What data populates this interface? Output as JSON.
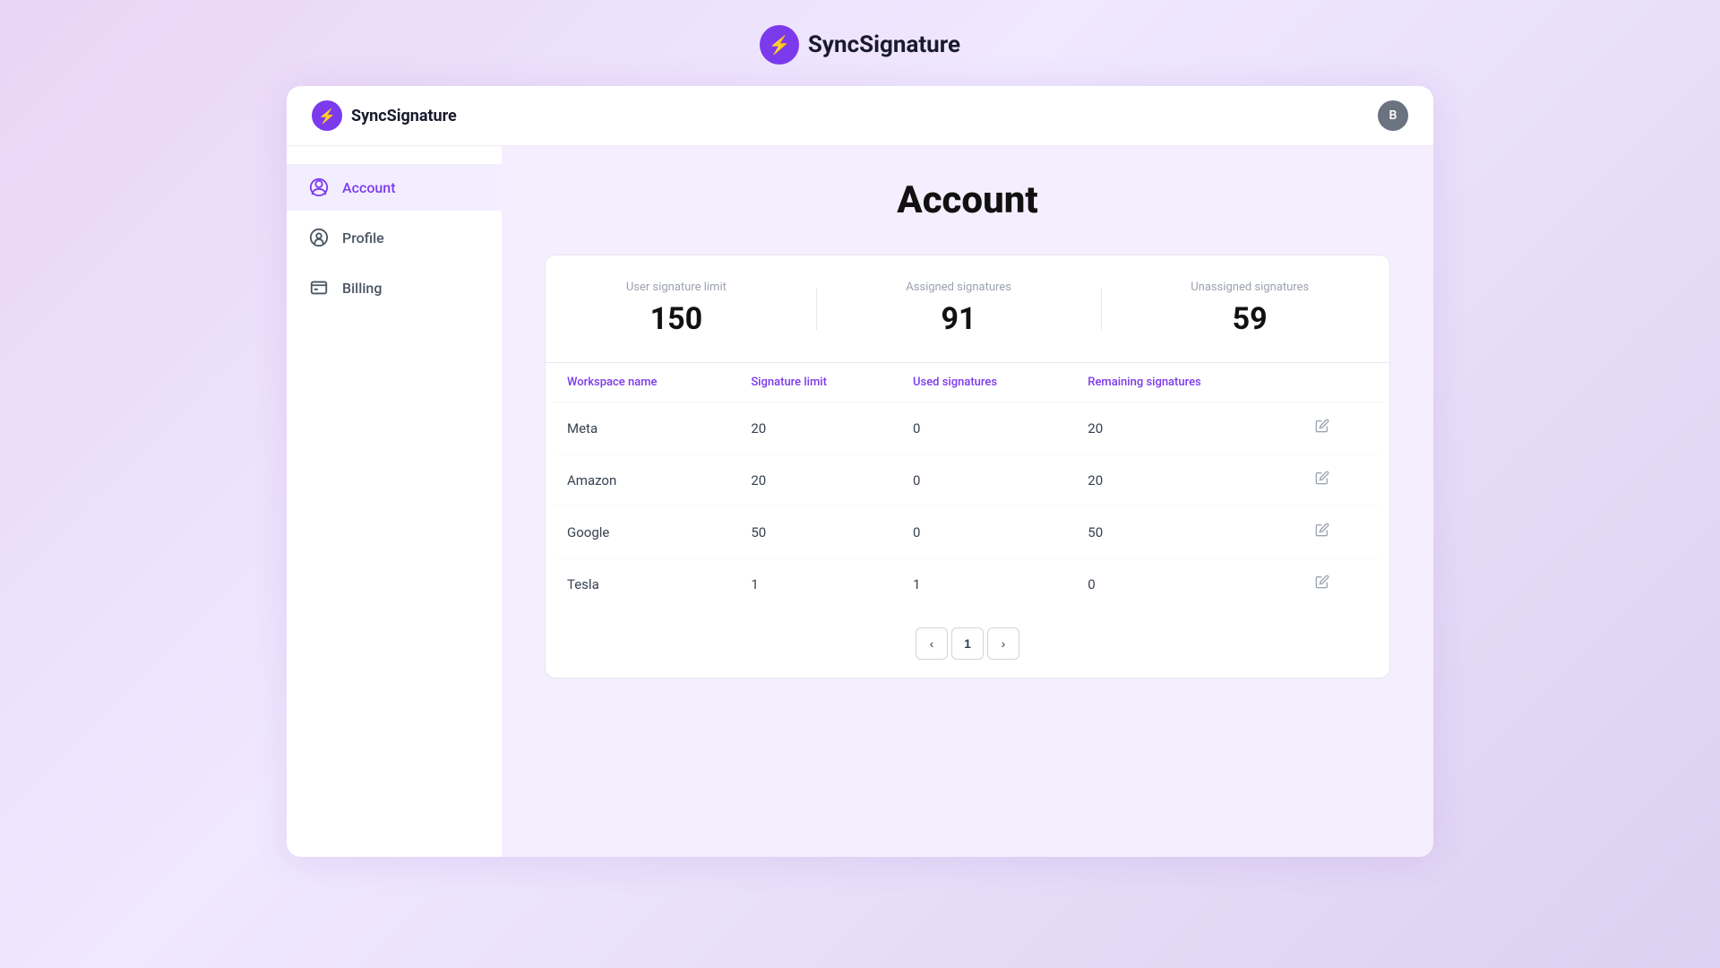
{
  "brand": {
    "name": "SyncSignature",
    "logo_icon": "⚡"
  },
  "header": {
    "avatar_letter": "B"
  },
  "sidebar": {
    "items": [
      {
        "id": "account",
        "label": "Account",
        "icon": "account",
        "active": true
      },
      {
        "id": "profile",
        "label": "Profile",
        "icon": "profile",
        "active": false
      },
      {
        "id": "billing",
        "label": "Billing",
        "icon": "billing",
        "active": false
      }
    ]
  },
  "main": {
    "page_title": "Account",
    "stats": {
      "user_signature_limit_label": "User signature limit",
      "user_signature_limit_value": "150",
      "assigned_signatures_label": "Assigned signatures",
      "assigned_signatures_value": "91",
      "unassigned_signatures_label": "Unassigned signatures",
      "unassigned_signatures_value": "59"
    },
    "table": {
      "columns": [
        {
          "id": "workspace_name",
          "label": "Workspace name"
        },
        {
          "id": "signature_limit",
          "label": "Signature limit"
        },
        {
          "id": "used_signatures",
          "label": "Used signatures"
        },
        {
          "id": "remaining_signatures",
          "label": "Remaining signatures"
        }
      ],
      "rows": [
        {
          "workspace_name": "Meta",
          "signature_limit": "20",
          "used_signatures": "0",
          "remaining_signatures": "20"
        },
        {
          "workspace_name": "Amazon",
          "signature_limit": "20",
          "used_signatures": "0",
          "remaining_signatures": "20"
        },
        {
          "workspace_name": "Google",
          "signature_limit": "50",
          "used_signatures": "0",
          "remaining_signatures": "50"
        },
        {
          "workspace_name": "Tesla",
          "signature_limit": "1",
          "used_signatures": "1",
          "remaining_signatures": "0"
        }
      ]
    },
    "pagination": {
      "current_page": "1",
      "prev_label": "‹",
      "next_label": "›"
    }
  }
}
